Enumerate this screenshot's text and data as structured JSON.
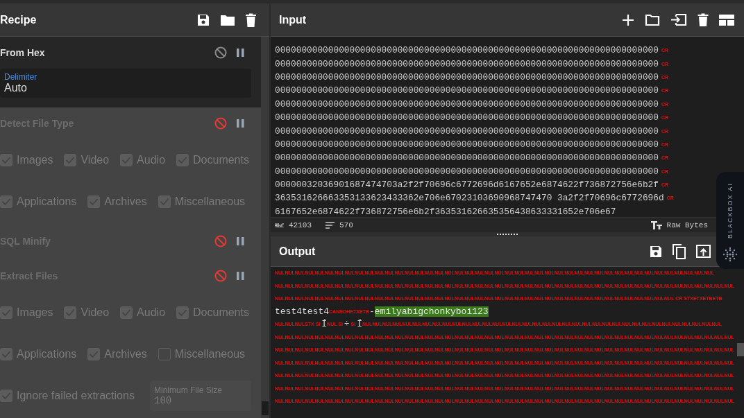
{
  "recipe": {
    "title": "Recipe",
    "operations": [
      {
        "name": "From Hex",
        "disabled": false,
        "args": [
          {
            "kind": "field",
            "label": "Delimiter",
            "value": "Auto"
          }
        ]
      },
      {
        "name": "Detect File Type",
        "disabled": true,
        "args": [
          {
            "kind": "checkbox",
            "label": "Images",
            "checked": true
          },
          {
            "kind": "checkbox",
            "label": "Video",
            "checked": true
          },
          {
            "kind": "checkbox",
            "label": "Audio",
            "checked": true
          },
          {
            "kind": "checkbox",
            "label": "Documents",
            "checked": true
          },
          {
            "kind": "checkbox",
            "label": "Applications",
            "checked": true
          },
          {
            "kind": "checkbox",
            "label": "Archives",
            "checked": true
          },
          {
            "kind": "checkbox",
            "label": "Miscellaneous",
            "checked": true
          }
        ]
      },
      {
        "name": "SQL Minify",
        "disabled": true
      },
      {
        "name": "Extract Files",
        "disabled": true,
        "args": [
          {
            "kind": "checkbox",
            "label": "Images",
            "checked": true
          },
          {
            "kind": "checkbox",
            "label": "Video",
            "checked": true
          },
          {
            "kind": "checkbox",
            "label": "Audio",
            "checked": true
          },
          {
            "kind": "checkbox",
            "label": "Documents",
            "checked": true
          },
          {
            "kind": "checkbox",
            "label": "Applications",
            "checked": true
          },
          {
            "kind": "checkbox",
            "label": "Archives",
            "checked": true
          },
          {
            "kind": "checkbox",
            "label": "Miscellaneous",
            "checked": false
          },
          {
            "kind": "checkbox",
            "label": "Ignore failed extractions",
            "checked": true
          },
          {
            "kind": "field",
            "label": "Minimum File Size",
            "value": "100"
          }
        ]
      }
    ]
  },
  "input": {
    "title": "Input",
    "lines": [
      {
        "text": "000000000000000000000000000000000000000000000000000000000000000000000000",
        "cr": "CR"
      },
      {
        "text": "000000000000000000000000000000000000000000000000000000000000000000000000",
        "cr": "CR"
      },
      {
        "text": "000000000000000000000000000000000000000000000000000000000000000000000000",
        "cr": "CR"
      },
      {
        "text": "000000000000000000000000000000000000000000000000000000000000000000000000",
        "cr": "CR"
      },
      {
        "text": "000000000000000000000000000000000000000000000000000000000000000000000000",
        "cr": "CR"
      },
      {
        "text": "000000000000000000000000000000000000000000000000000000000000000000000000",
        "cr": "CR"
      },
      {
        "text": "000000000000000000000000000000000000000000000000000000000000000000000000",
        "cr": "CR"
      },
      {
        "text": "000000000000000000000000000000000000000000000000000000000000000000000000",
        "cr": "CR"
      },
      {
        "text": "000000000000000000000000000000000000000000000000000000000000000000000000",
        "cr": "CR"
      },
      {
        "text": "000000000000000000000000000000000000000000000000000000000000000000000000",
        "cr": "CR"
      },
      {
        "text": "00000032036901687474703a2f2f70696c6772696d6167652e6874622f736872756e6b2f",
        "cr": "CR"
      },
      {
        "text": "363531626663353133623433362e706e67023103690968747470 3a2f2f70696c6772696d",
        "cr": "CR"
      },
      {
        "text": "6167652e6874622f736872756e6b2f363531626635356438633331652e706e67"
      }
    ],
    "length": "42103",
    "line_count": "570",
    "format": "Raw Bytes"
  },
  "output": {
    "title": "Output",
    "lines": [
      [
        {
          "kind": "ctrl",
          "text": "NULNULNULNULNULNULNULNULNULNULNULNULNULNULNULNULNULNULNULNULNULNULNULNULNULNULNULNULNULNULNULNULNULNULNULNULNULNULNULNULNULNULNULNUL"
        }
      ],
      [
        {
          "kind": "ctrl",
          "text": "NULNULNULNULNULNULNULNULNULNULNULNULNULNULNULNULNULNULNULNULNULNULNULNULNULNULNULNULNULNULNULNULNULNULNULNULNULNULNULNULNULNULNULNULNULNUL"
        }
      ],
      [
        {
          "kind": "ctrl",
          "text": "NULNULNULNULNULNULNULNULNULNULNULNULNULNULNULNULNULNULNULNULNULNULNULNULNULNULNULNULNULNULNULNULNULNULNULNULNULNULNULNUL CR STXETXETBETB"
        }
      ],
      [
        {
          "kind": "text",
          "text": "test4test4"
        },
        {
          "kind": "ctrl",
          "text": "CANSOHETXETB"
        },
        {
          "kind": "text",
          "text": "-"
        },
        {
          "kind": "highlight",
          "text": "emilyabigchonkyboi123"
        }
      ],
      [
        {
          "kind": "ctrl",
          "text": "NULNULNULSTX SI "
        },
        {
          "kind": "text",
          "text": "Í"
        },
        {
          "kind": "ctrl",
          "text": "NUL SI "
        },
        {
          "kind": "text",
          "text": "÷"
        },
        {
          "kind": "ctrl",
          "text": " SI "
        },
        {
          "kind": "text",
          "text": "Í"
        },
        {
          "kind": "ctrl",
          "text": "NULNULNULNULNULNULNULNULNULNULNULNULNULNULNULNULNULNULNULNULNULNULNULNULNULNULNULNULNULNULNULNULNULNULNULNUL"
        }
      ],
      [
        {
          "kind": "ctrl",
          "text": "NULNULNULNULNULNULNULNULNULNULNULNULNULNULNULNULNULNULNULNULNULNULNULNULNULNULNULNULNULNULNULNULNULNULNULNULNULNULNULNULNULNULNULNULNULNUL"
        }
      ],
      [
        {
          "kind": "ctrl",
          "text": "NULNULNULNULNULNULNULNULNULNULNULNULNULNULNULNULNULNULNULNULNULNULNULNULNULNULNULNULNULNULNULNULNULNULNULNULNULNULNULNULNULNULNULNULNULNUL"
        }
      ],
      [
        {
          "kind": "ctrl",
          "text": "NULNULNULNULNULNULNULNULNULNULNULNULNULNULNULNULNULNULNULNULNULNULNULNULNULNULNULNULNULNULNULNULNULNULNULNULNULNULNULNULNULNULNULNULNULNUL"
        }
      ],
      [
        {
          "kind": "ctrl",
          "text": "NULNULNULNULNULNULNULNULNULNULNULNULNULNULNULNULNULNULNULNULNULNULNULNULNULNULNULNULNULNULNULNULNULNULNULNULNULNULNULNULNULNULNULNULNULNUL"
        }
      ],
      [
        {
          "kind": "ctrl",
          "text": "NULNULNULNULNULNULNULNULNULNULNULNULNULNULNULNULNULNULNULNULNULNULNULNULNULNULNULNULNULNULNULNULNULNULNULNULNULNULNULNULNULNULNULNULNULNUL"
        }
      ],
      [
        {
          "kind": "ctrl",
          "text": "NULNULNULNULNULNULNULNULNULNULNULNULNULNULNULNULNULNULNULNULNULNULNULNULNULNULNULNULNULNULNULNULNULNULNULNULNULNULNULNULNULNULNULNULNULNUL"
        }
      ]
    ]
  },
  "assistant_tab": {
    "label": "BLACKBOX AI"
  }
}
